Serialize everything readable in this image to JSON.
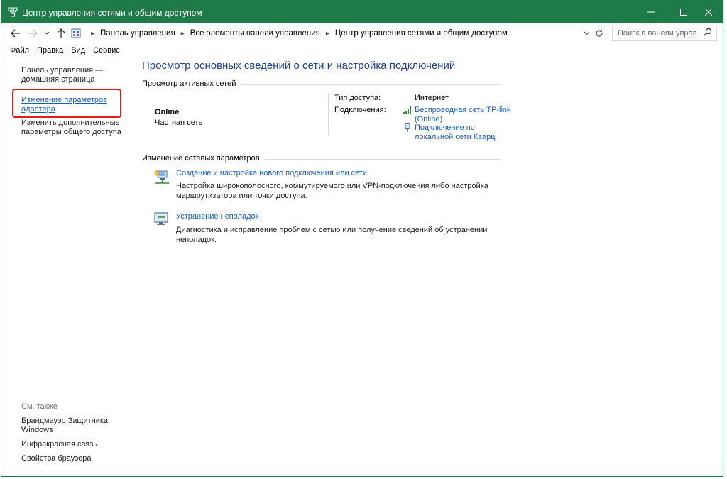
{
  "window": {
    "title": "Центр управления сетями и общим доступом",
    "accent_color": "#1e7a48",
    "controls": {
      "minimize": "—",
      "maximize": "☐",
      "close": "✕"
    }
  },
  "addressbar": {
    "breadcrumbs": [
      "Панель управления",
      "Все элементы панели управления",
      "Центр управления сетями и общим доступом"
    ],
    "search_placeholder": "Поиск в панели управ..."
  },
  "menubar": {
    "items": [
      "Файл",
      "Правка",
      "Вид",
      "Сервис"
    ]
  },
  "sidebar": {
    "home_link": "Панель управления — домашняя страница",
    "adapter_link": "Изменение параметров адаптера",
    "sharing_link": "Изменить дополнительные параметры общего доступа",
    "see_also_label": "См. также",
    "see_also": [
      "Брандмауэр Защитника Windows",
      "Инфракрасная связь",
      "Свойства браузера"
    ]
  },
  "main": {
    "title": "Просмотр основных сведений о сети и настройка подключений",
    "active_networks_label": "Просмотр активных сетей",
    "network": {
      "name": "Online",
      "type": "Частная сеть",
      "access_type_label": "Тип доступа:",
      "access_type_value": "Интернет",
      "connections_label": "Подключения:",
      "connections": [
        "Беспроводная сеть TP-link (Online)",
        "Подключение по локальной сети Кварц"
      ]
    },
    "change_settings_label": "Изменение сетевых параметров",
    "tasks": [
      {
        "icon": "new-connection-icon",
        "link": "Создание и настройка нового подключения или сети",
        "description": "Настройка широкополосного, коммутируемого или VPN-подключения либо настройка маршрутизатора или точки доступа."
      },
      {
        "icon": "troubleshoot-icon",
        "link": "Устранение неполадок",
        "description": "Диагностика и исправление проблем с сетью или получение сведений об устранении неполадок."
      }
    ]
  }
}
